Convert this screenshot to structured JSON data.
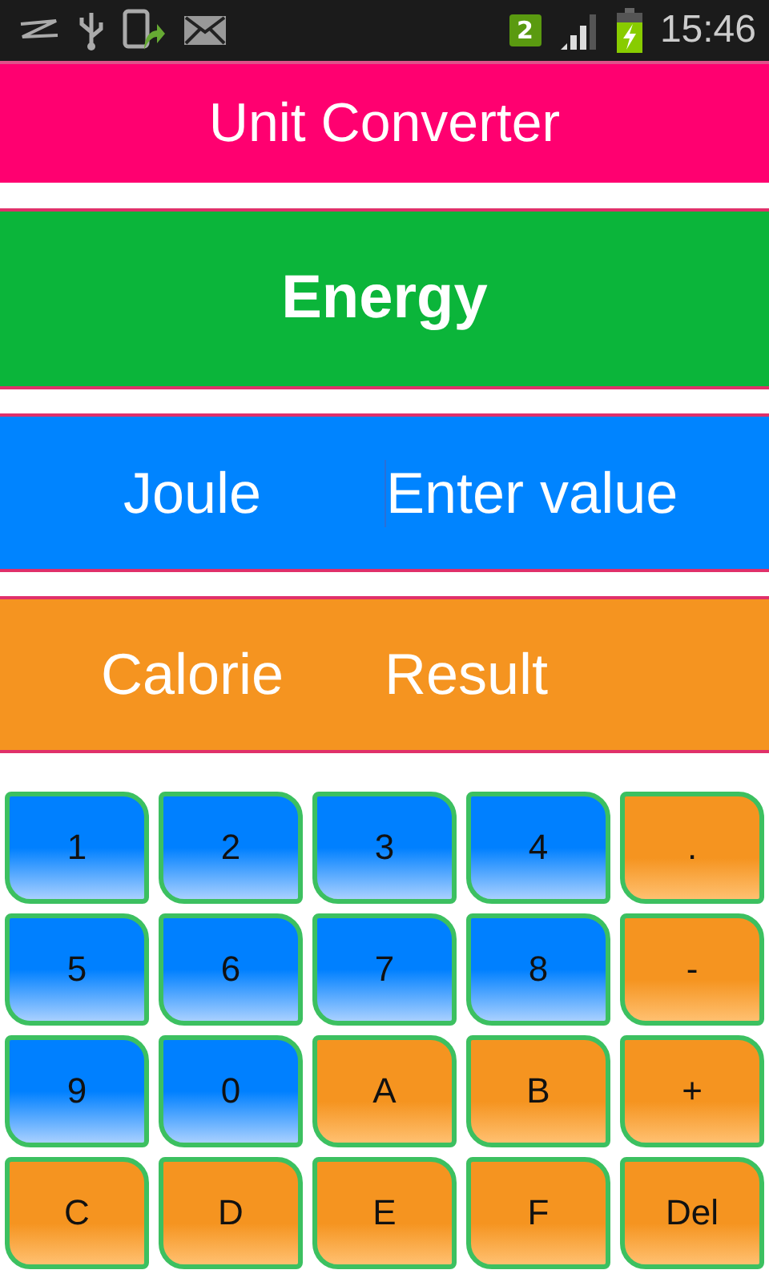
{
  "status_bar": {
    "sim_badge": "2",
    "time": "15:46"
  },
  "title": "Unit Converter",
  "category": "Energy",
  "input": {
    "unit": "Joule",
    "placeholder": "Enter value"
  },
  "output": {
    "unit": "Calorie",
    "value": "Result"
  },
  "keys": [
    {
      "label": "1",
      "kind": "digit"
    },
    {
      "label": "2",
      "kind": "digit"
    },
    {
      "label": "3",
      "kind": "digit"
    },
    {
      "label": "4",
      "kind": "digit"
    },
    {
      "label": ".",
      "kind": "symbol"
    },
    {
      "label": "5",
      "kind": "digit"
    },
    {
      "label": "6",
      "kind": "digit"
    },
    {
      "label": "7",
      "kind": "digit"
    },
    {
      "label": "8",
      "kind": "digit"
    },
    {
      "label": "-",
      "kind": "symbol"
    },
    {
      "label": "9",
      "kind": "digit"
    },
    {
      "label": "0",
      "kind": "digit"
    },
    {
      "label": "A",
      "kind": "symbol"
    },
    {
      "label": "B",
      "kind": "symbol"
    },
    {
      "label": "+",
      "kind": "symbol"
    },
    {
      "label": "C",
      "kind": "symbol"
    },
    {
      "label": "D",
      "kind": "symbol"
    },
    {
      "label": "E",
      "kind": "symbol"
    },
    {
      "label": "F",
      "kind": "symbol"
    },
    {
      "label": "Del",
      "kind": "symbol"
    }
  ]
}
